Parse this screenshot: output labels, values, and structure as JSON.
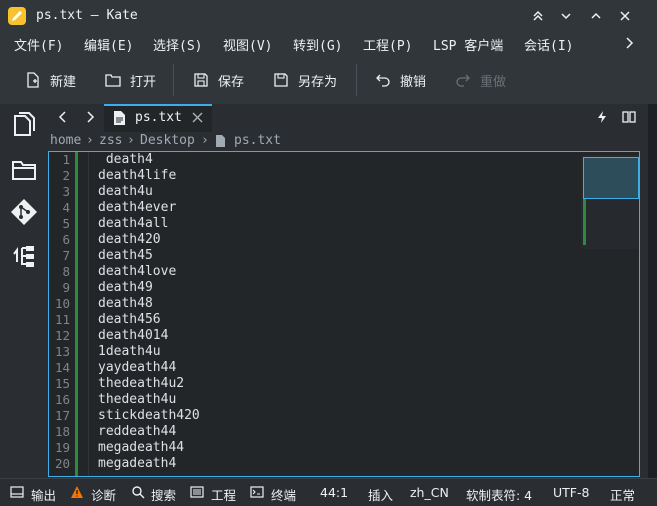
{
  "window": {
    "title": "ps.txt — Kate"
  },
  "menu": [
    "文件(F)",
    "编辑(E)",
    "选择(S)",
    "视图(V)",
    "转到(G)",
    "工程(P)",
    "LSP 客户端",
    "会话(I)"
  ],
  "toolbar": {
    "new": "新建",
    "open": "打开",
    "save": "保存",
    "save_as": "另存为",
    "undo": "撤销",
    "redo": "重做"
  },
  "tab": {
    "label": "ps.txt"
  },
  "breadcrumb": [
    "home",
    "zss",
    "Desktop",
    "ps.txt"
  ],
  "editor": {
    "lines": [
      {
        "n": "1",
        "t": " death4"
      },
      {
        "n": "2",
        "t": "death4life"
      },
      {
        "n": "3",
        "t": "death4u"
      },
      {
        "n": "4",
        "t": "death4ever"
      },
      {
        "n": "5",
        "t": "death4all"
      },
      {
        "n": "6",
        "t": "death420"
      },
      {
        "n": "7",
        "t": "death45"
      },
      {
        "n": "8",
        "t": "death4love"
      },
      {
        "n": "9",
        "t": "death49"
      },
      {
        "n": "10",
        "t": "death48"
      },
      {
        "n": "11",
        "t": "death456"
      },
      {
        "n": "12",
        "t": "death4014"
      },
      {
        "n": "13",
        "t": "1death4u"
      },
      {
        "n": "14",
        "t": "yaydeath44"
      },
      {
        "n": "15",
        "t": "thedeath4u2"
      },
      {
        "n": "16",
        "t": "thedeath4u"
      },
      {
        "n": "17",
        "t": "stickdeath420"
      },
      {
        "n": "18",
        "t": "reddeath44"
      },
      {
        "n": "19",
        "t": "megadeath44"
      },
      {
        "n": "20",
        "t": "megadeath4"
      }
    ]
  },
  "status": {
    "output": "输出",
    "diagnostics": "诊断",
    "search": "搜索",
    "project": "工程",
    "terminal": "终端",
    "cursor": "44:1",
    "mode": "插入",
    "language": "zh_CN",
    "indent": "软制表符: 4",
    "encoding": "UTF-8",
    "eol": "正常"
  },
  "colors": {
    "accent": "#3daee9",
    "modified": "#2e8b3b",
    "bg": "#232629"
  }
}
